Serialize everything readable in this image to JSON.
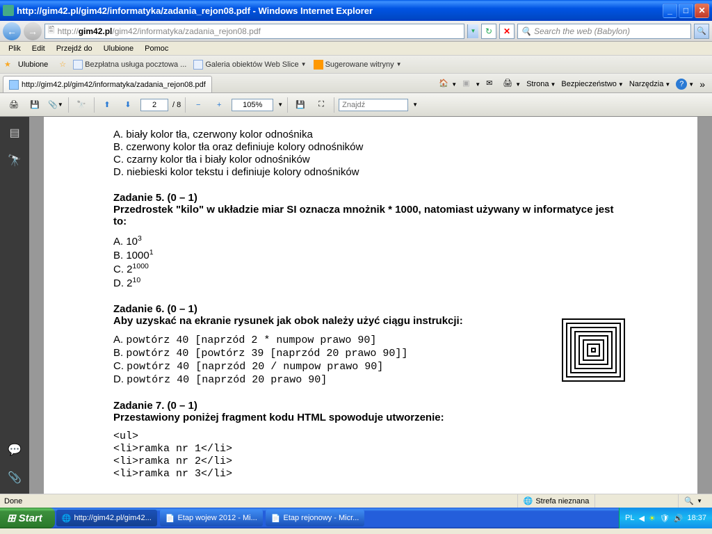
{
  "window": {
    "title": "http://gim42.pl/gim42/informatyka/zadania_rejon08.pdf - Windows Internet Explorer",
    "url_display": "http://gim42.pl/gim42/informatyka/zadania_rejon08.pdf",
    "search_placeholder": "Search the web (Babylon)"
  },
  "menu": {
    "file": "Plik",
    "edit": "Edit",
    "goto": "Przejdź do",
    "favorites": "Ulubione",
    "help": "Pomoc"
  },
  "favbar": {
    "label": "Ulubione",
    "link1": "Bezpłatna usługa pocztowa ...",
    "link2": "Galeria obiektów Web Slice",
    "link3": "Sugerowane witryny"
  },
  "tab": {
    "title": "http://gim42.pl/gim42/informatyka/zadania_rejon08.pdf"
  },
  "command_bar": {
    "page": "Strona",
    "safety": "Bezpieczeństwo",
    "tools": "Narzędzia"
  },
  "pdf_toolbar": {
    "page_current": "2",
    "page_total": "/  8",
    "zoom": "105%",
    "find_placeholder": "Znajdź"
  },
  "doc": {
    "q4": {
      "a": "A.  biały kolor tła, czerwony kolor odnośnika",
      "b": "B.  czerwony kolor tła oraz definiuje kolory odnośników",
      "c": "C.  czarny kolor tła i biały kolor odnośników",
      "d": "D.  niebieski kolor tekstu i definiuje kolory odnośników"
    },
    "q5": {
      "title": "Zadanie 5. (0 – 1)",
      "text": "Przedrostek \"kilo\" w układzie miar SI oznacza mnożnik * 1000, natomiast używany w informatyce jest to:",
      "a_pre": "A.  10",
      "a_sup": "3",
      "b_pre": "B.  1000",
      "b_sup": "1",
      "c_pre": "C.  2",
      "c_sup": "1000",
      "d_pre": "D.  2",
      "d_sup": "10"
    },
    "q6": {
      "title": "Zadanie 6. (0 – 1)",
      "text": "Aby uzyskać na ekranie rysunek jak obok należy użyć ciągu instrukcji:",
      "a_label": "A. ",
      "a_code": "powtórz 40 [naprzód 2 * numpow prawo 90]",
      "b_label": "B. ",
      "b_code": "powtórz 40 [powtórz 39 [naprzód 20 prawo 90]]",
      "c_label": "C. ",
      "c_code": "powtórz 40 [naprzód 20 / numpow prawo 90]",
      "d_label": "D. ",
      "d_code": "powtórz 40 [naprzód 20 prawo 90]"
    },
    "q7": {
      "title": "Zadanie 7. (0 – 1)",
      "text": "Przestawiony poniżej fragment kodu HTML spowoduje utworzenie:",
      "code1": "<ul>",
      "code2": "   <li>ramka nr 1</li>",
      "code3": "   <li>ramka nr 2</li>",
      "code4": "   <li>ramka nr 3</li>"
    }
  },
  "statusbar": {
    "done": "Done",
    "zone": "Strefa nieznana"
  },
  "taskbar": {
    "start": "Start",
    "task1": "http://gim42.pl/gim42...",
    "task2": "Etap wojew 2012 - Mi...",
    "task3": "Etap rejonowy - Micr...",
    "lang": "PL",
    "time": "18:37"
  }
}
